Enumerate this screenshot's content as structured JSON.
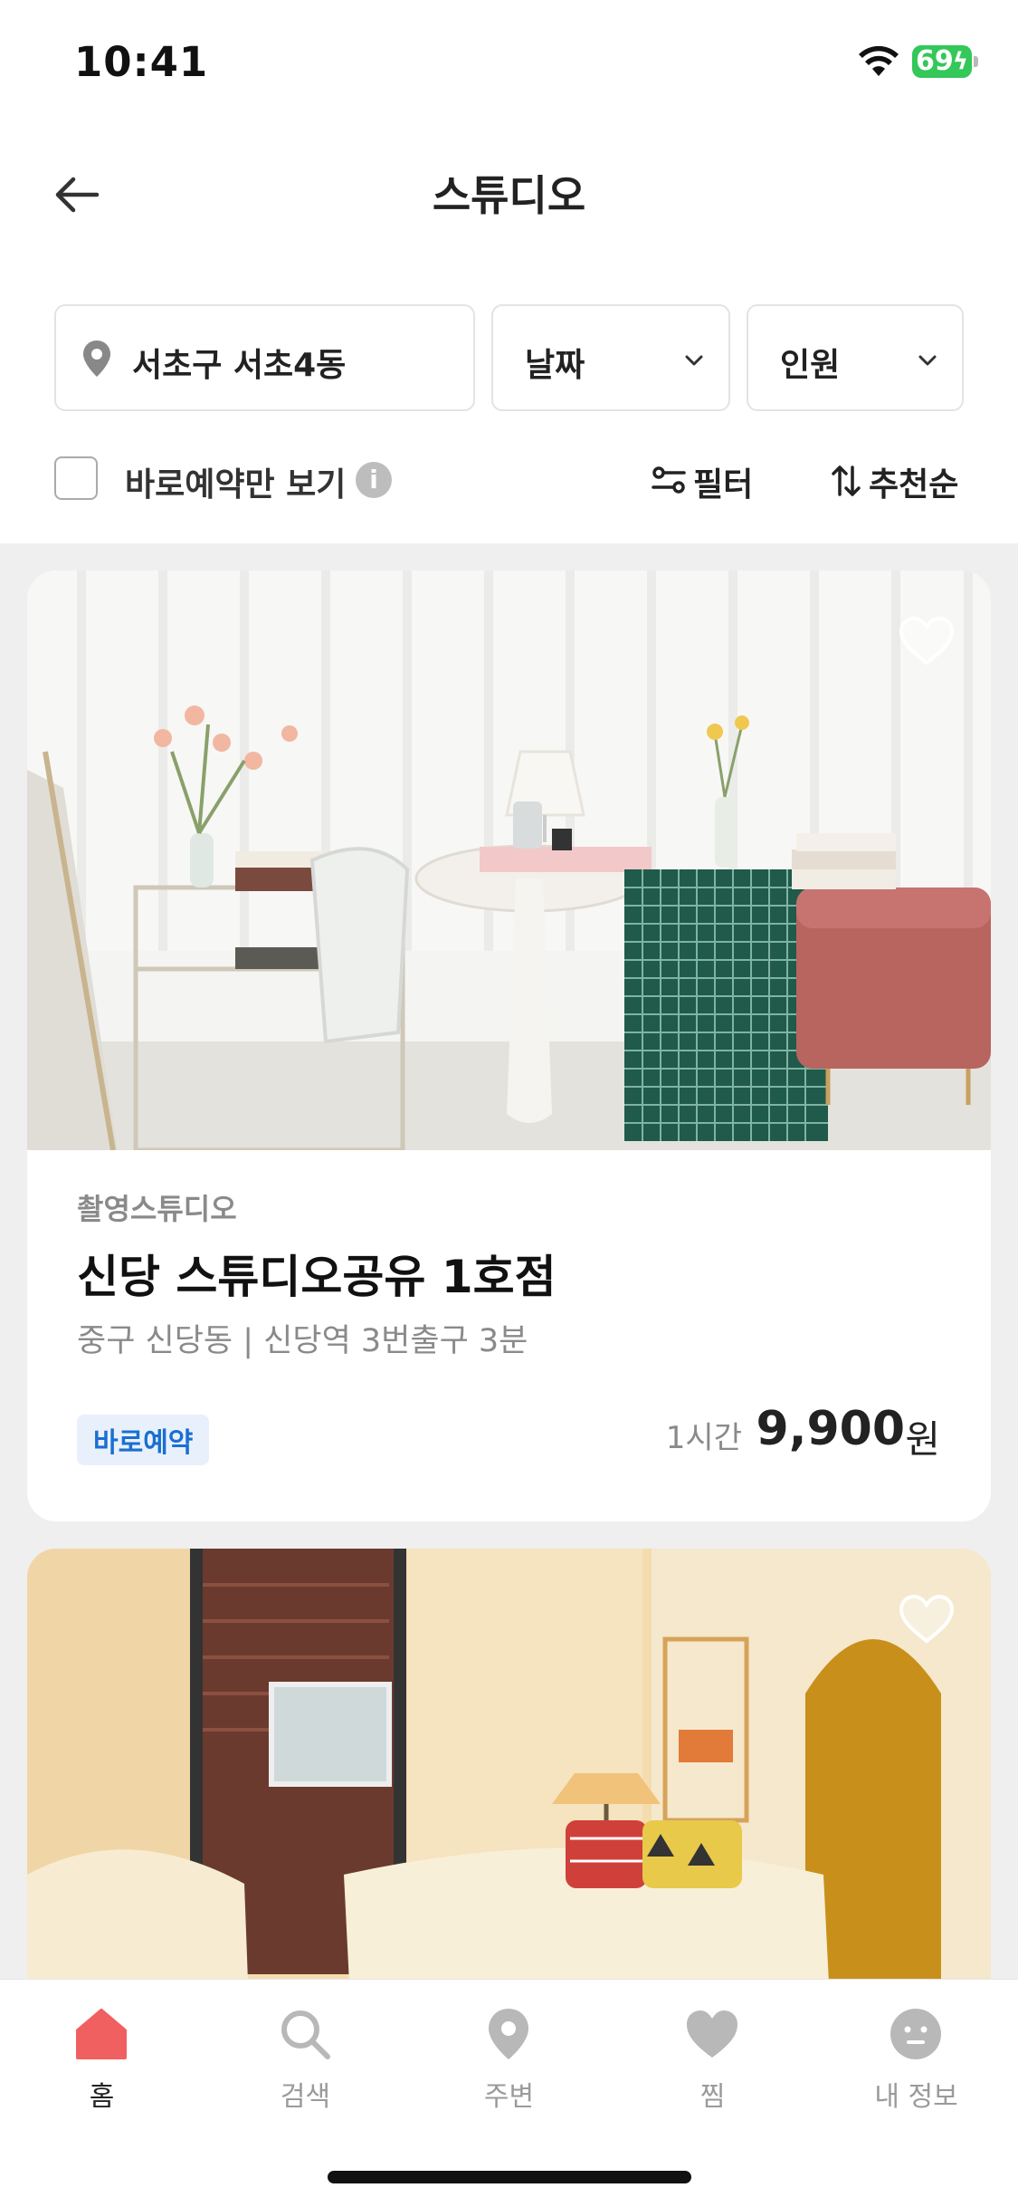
{
  "status": {
    "time": "10:41",
    "battery": "69"
  },
  "header": {
    "title": "스튜디오"
  },
  "filters": {
    "location": "서초구 서초4동",
    "date": "날짜",
    "people": "인원"
  },
  "options": {
    "instant_only_label": "바로예약만 보기",
    "filter_label": "필터",
    "sort_label": "추천순"
  },
  "listings": [
    {
      "category": "촬영스튜디오",
      "title": "신당 스튜디오공유 1호점",
      "location": "중구 신당동 | 신당역 3번출구 3분",
      "badge": "바로예약",
      "price_unit": "1시간",
      "price": "9,900",
      "currency": "원"
    }
  ],
  "tabs": [
    {
      "label": "홈",
      "icon": "home-icon",
      "active": true
    },
    {
      "label": "검색",
      "icon": "search-icon"
    },
    {
      "label": "주변",
      "icon": "location-pin-icon"
    },
    {
      "label": "찜",
      "icon": "heart-icon"
    },
    {
      "label": "내 정보",
      "icon": "profile-icon"
    }
  ],
  "colors": {
    "accent": "#f06060",
    "badge_text": "#1a6fd1",
    "badge_bg": "#e8f1fb",
    "battery": "#34c759"
  }
}
